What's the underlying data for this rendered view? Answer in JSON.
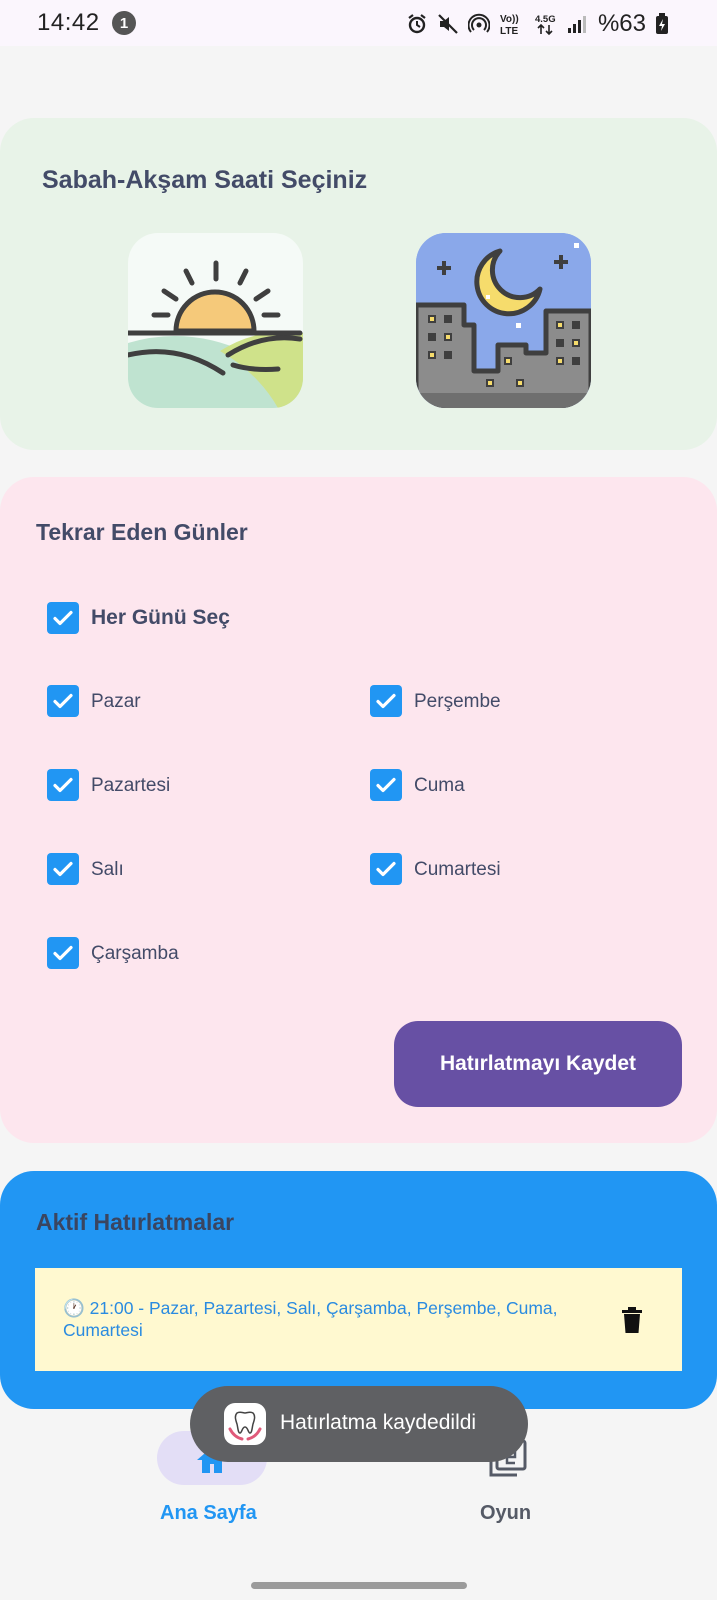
{
  "status_bar": {
    "time": "14:42",
    "notification_count": "1",
    "battery": "%63",
    "icons": [
      "alarm-icon",
      "mute-icon",
      "hotspot-icon",
      "volte-icon",
      "network-4.5g-icon",
      "signal-icon",
      "battery-icon"
    ]
  },
  "morning_evening": {
    "title": "Sabah-Akşam Saati Seçiniz",
    "options": [
      "sunrise-icon",
      "night-city-icon"
    ]
  },
  "days": {
    "title": "Tekrar Eden Günler",
    "select_all": {
      "label": "Her Günü Seç",
      "checked": true
    },
    "left_column": [
      {
        "label": "Pazar",
        "checked": true
      },
      {
        "label": "Pazartesi",
        "checked": true
      },
      {
        "label": "Salı",
        "checked": true
      },
      {
        "label": "Çarşamba",
        "checked": true
      }
    ],
    "right_column": [
      {
        "label": "Perşembe",
        "checked": true
      },
      {
        "label": "Cuma",
        "checked": true
      },
      {
        "label": "Cumartesi",
        "checked": true
      }
    ],
    "save_label": "Hatırlatmayı Kaydet"
  },
  "active": {
    "title": "Aktif Hatırlatmalar",
    "reminders": [
      {
        "text": "🕐 21:00 - Pazar, Pazartesi, Salı, Çarşamba, Perşembe, Cuma, Cumartesi"
      }
    ]
  },
  "toast": {
    "text": "Hatırlatma kaydedildi"
  },
  "bottom_nav": {
    "home_label": "Ana Sayfa",
    "game_label": "Oyun"
  },
  "colors": {
    "accent": "#2196f3",
    "primary_button": "#6750a4",
    "card_green": "#e8f3e8",
    "card_pink": "#fde6ee",
    "reminder_bg": "#fff9d0"
  }
}
